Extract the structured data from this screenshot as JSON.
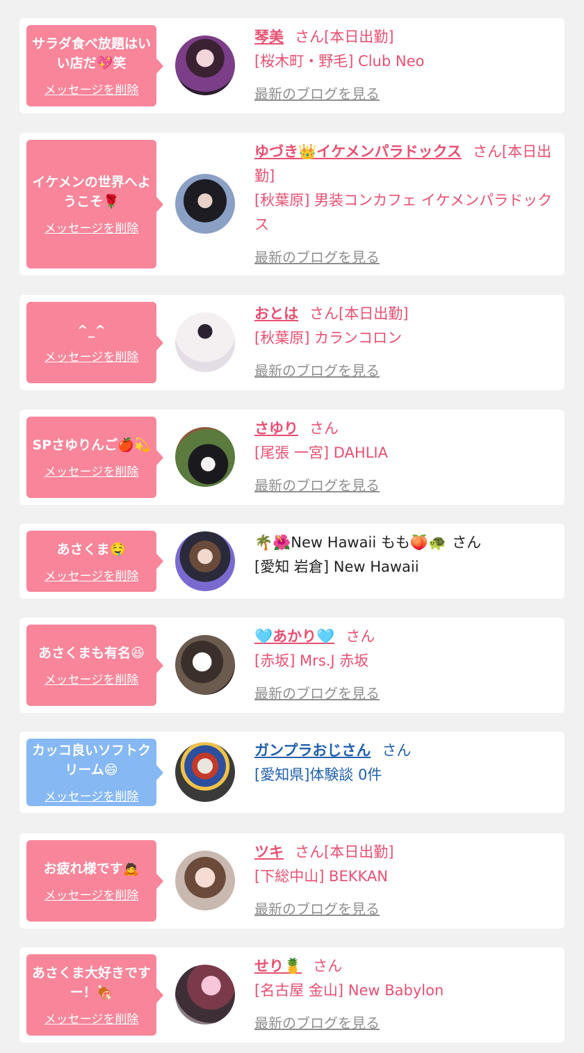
{
  "delete_label": "メッセージを削除",
  "blog_label": "最新のブログを見る",
  "colors": {
    "bubble_pink": "#f8859a",
    "bubble_blue": "#86b8f4",
    "name_pink": "#e84f71",
    "name_blue": "#1f5fae",
    "background": "#f1f1f1"
  },
  "cards": [
    {
      "message": "サラダ食べ放題はいい店だ💖笑",
      "name": "琴美",
      "suffix": "さん[本日出勤]",
      "shop": "[桜木町・野毛] Club Neo"
    },
    {
      "message": "イケメンの世界へようこそ🌹",
      "name": "ゆづき👑イケメンパラドックス",
      "suffix": "さん[本日出勤]",
      "shop": "[秋葉原] 男装コンカフェ イケメンパラドックス"
    },
    {
      "message": "^_^",
      "name": "おとは",
      "suffix": "さん[本日出勤]",
      "shop": "[秋葉原] カランコロン"
    },
    {
      "message": "SPさゆりんご🍎💫",
      "name": "さゆり",
      "suffix": "さん",
      "shop": "[尾張 一宮] DAHLIA"
    },
    {
      "message": "あさくま🤤",
      "name": "🌴🌺New Hawaii もも🍑🐢",
      "suffix": "さん",
      "shop": "[愛知 岩倉] New Hawaii"
    },
    {
      "message": "あさくまも有名😆",
      "name": "🩵あかり🩵",
      "suffix": "さん",
      "shop": "[赤坂] Mrs.J 赤坂"
    },
    {
      "message": "カッコ良いソフトクリーム😄",
      "name": "ガンプラおじさん",
      "suffix": "さん",
      "shop": "[愛知県]体験談 0件"
    },
    {
      "message": "お疲れ様です🙇",
      "name": "ツキ",
      "suffix": "さん[本日出勤]",
      "shop": "[下総中山] BEKKAN"
    },
    {
      "message": "あさくま大好きですー！🍖",
      "name": "せり🍍",
      "suffix": "さん",
      "shop": "[名古屋 金山] New Babylon"
    }
  ]
}
